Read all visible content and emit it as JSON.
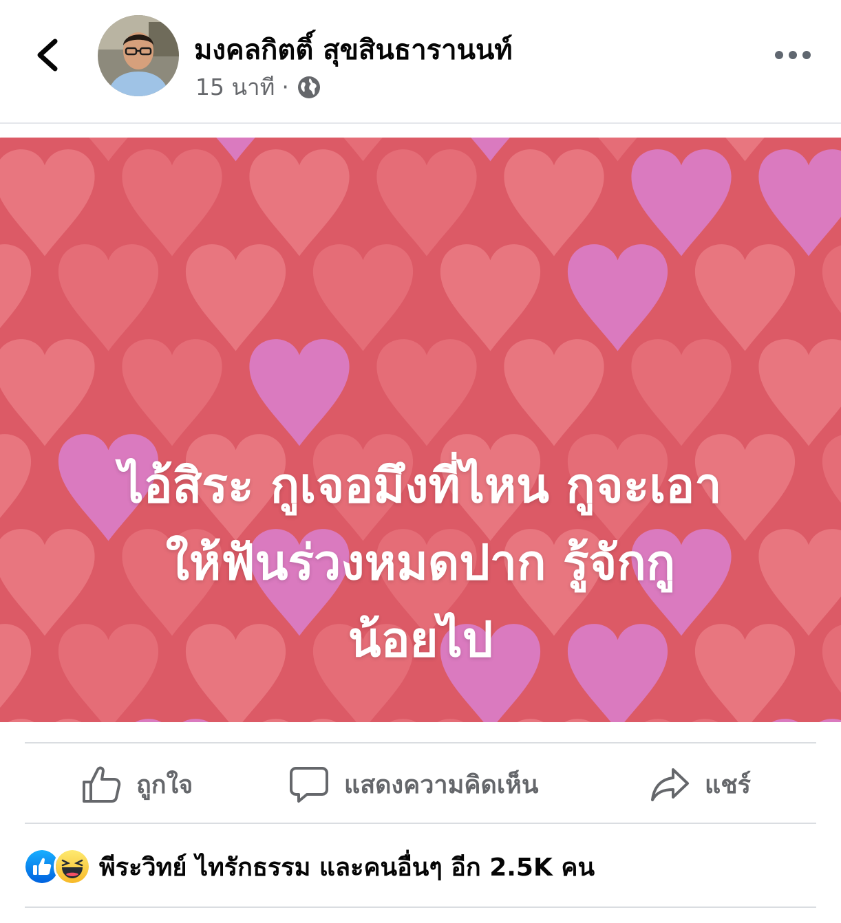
{
  "post": {
    "author_name": "มงคลกิตติ์ สุขสินธารานนท์",
    "time": "15 นาที",
    "separator": "·",
    "privacy_icon": "globe-icon",
    "text_lines": [
      "ไอ้สิระ กูเจอมึงที่ไหน กูจะเอา",
      "ให้ฟันร่วงหมดปาก รู้จักกู",
      "น้อยไป"
    ],
    "background": {
      "base_color": "#dc5a66",
      "heart_colors": [
        "#e8747e",
        "#ec8088",
        "#d97cc4",
        "#e26a74"
      ]
    }
  },
  "actions": {
    "like_label": "ถูกใจ",
    "comment_label": "แสดงความคิดเห็น",
    "share_label": "แชร์"
  },
  "reactions": {
    "icons": [
      "like-reaction-icon",
      "haha-reaction-icon"
    ],
    "summary": "พีระวิทย์ ไทรักธรรม และคนอื่นๆ อีก 2.5K คน"
  },
  "colors": {
    "secondary_text": "#65676b",
    "like_blue": "#1877f2",
    "haha_yellow": "#f7b928"
  }
}
